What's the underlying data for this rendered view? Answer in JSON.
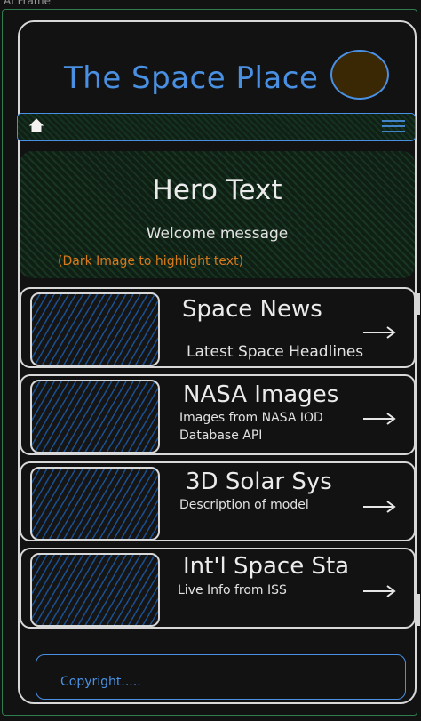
{
  "frame": {
    "label": "AI Frame"
  },
  "header": {
    "title": "The Space Place"
  },
  "nav": {
    "home_icon": "home-icon",
    "menu_icon": "hamburger-menu-icon"
  },
  "hero": {
    "title": "Hero Text",
    "subtitle": "Welcome message",
    "note": "(Dark Image to highlight text)"
  },
  "cards": [
    {
      "title": "Space News",
      "description": "Latest Space Headlines",
      "icon": "arrow-right-icon"
    },
    {
      "title": "NASA Images",
      "description": "Images from NASA IOD\nDatabase API",
      "icon": "arrow-right-icon"
    },
    {
      "title": "3D Solar Sys",
      "description": "Description of model",
      "icon": "arrow-right-icon"
    },
    {
      "title": "Int'l Space Sta",
      "description": "Live Info from ISS",
      "icon": "arrow-right-icon"
    }
  ],
  "footer": {
    "text": "Copyright....."
  },
  "colors": {
    "accent": "#4a90e2",
    "hero_note": "#d97a1a",
    "frame_border": "#2f7d4f",
    "logo_fill": "#3a2704"
  }
}
